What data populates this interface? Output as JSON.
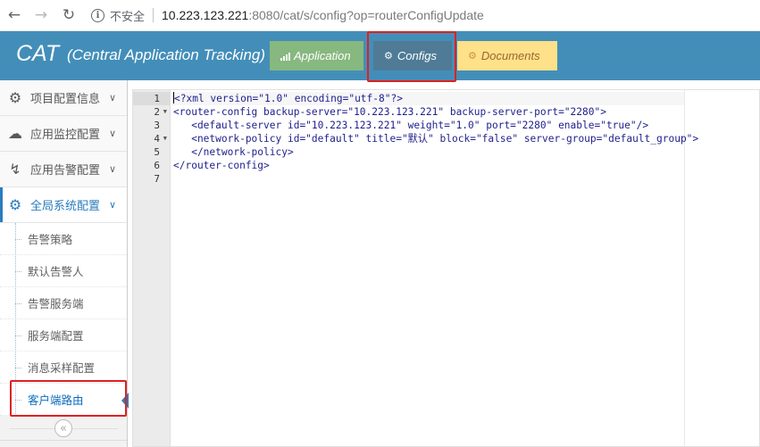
{
  "browser": {
    "insecure_label": "不安全",
    "url_host": "10.223.123.221",
    "url_rest": ":8080/cat/s/config?op=routerConfigUpdate"
  },
  "header": {
    "brand": "CAT",
    "brand_sub": "(Central Application Tracking)",
    "buttons": {
      "application": "Application",
      "configs": "Configs",
      "documents": "Documents"
    },
    "colors": {
      "bar": "#438eb9",
      "application": "#87b87f",
      "configs": "#4f7b96",
      "documents": "#fee188"
    }
  },
  "sidebar": {
    "menu": [
      {
        "label": "项目配置信息",
        "icon": "gears-icon"
      },
      {
        "label": "应用监控配置",
        "icon": "cloud-icon"
      },
      {
        "label": "应用告警配置",
        "icon": "bolt-icon"
      },
      {
        "label": "全局系统配置",
        "icon": "gear-icon"
      }
    ],
    "submenu": [
      "告警策略",
      "默认告警人",
      "告警服务端",
      "服务端配置",
      "消息采样配置",
      "客户端路由"
    ]
  },
  "editor": {
    "line_numbers": [
      "1",
      "2",
      "3",
      "4",
      "5",
      "6",
      "7"
    ],
    "lines": [
      "<?xml version=\"1.0\" encoding=\"utf-8\"?>",
      "<router-config backup-server=\"10.223.123.221\" backup-server-port=\"2280\">",
      "   <default-server id=\"10.223.123.221\" weight=\"1.0\" port=\"2280\" enable=\"true\"/>",
      "   <network-policy id=\"default\" title=\"默认\" block=\"false\" server-group=\"default_group\">",
      "   </network-policy>",
      "</router-config>",
      ""
    ]
  }
}
